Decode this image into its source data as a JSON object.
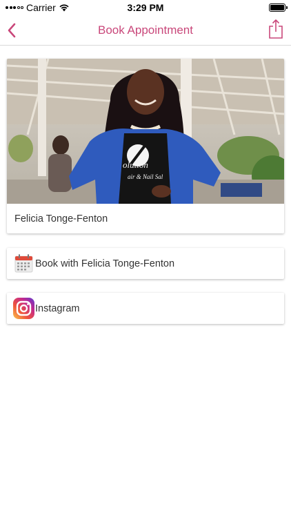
{
  "status_bar": {
    "carrier": "Carrier",
    "time": "3:29 PM"
  },
  "nav": {
    "title": "Book Appointment",
    "back_icon": "chevron-left-icon",
    "share_icon": "share-icon",
    "accent_color": "#c9477a"
  },
  "profile": {
    "name": "Felicia Tonge-Fenton"
  },
  "actions": [
    {
      "label": "Book with Felicia Tonge-Fenton",
      "icon": "calendar-icon"
    },
    {
      "label": "Instagram",
      "icon": "instagram-icon"
    }
  ]
}
